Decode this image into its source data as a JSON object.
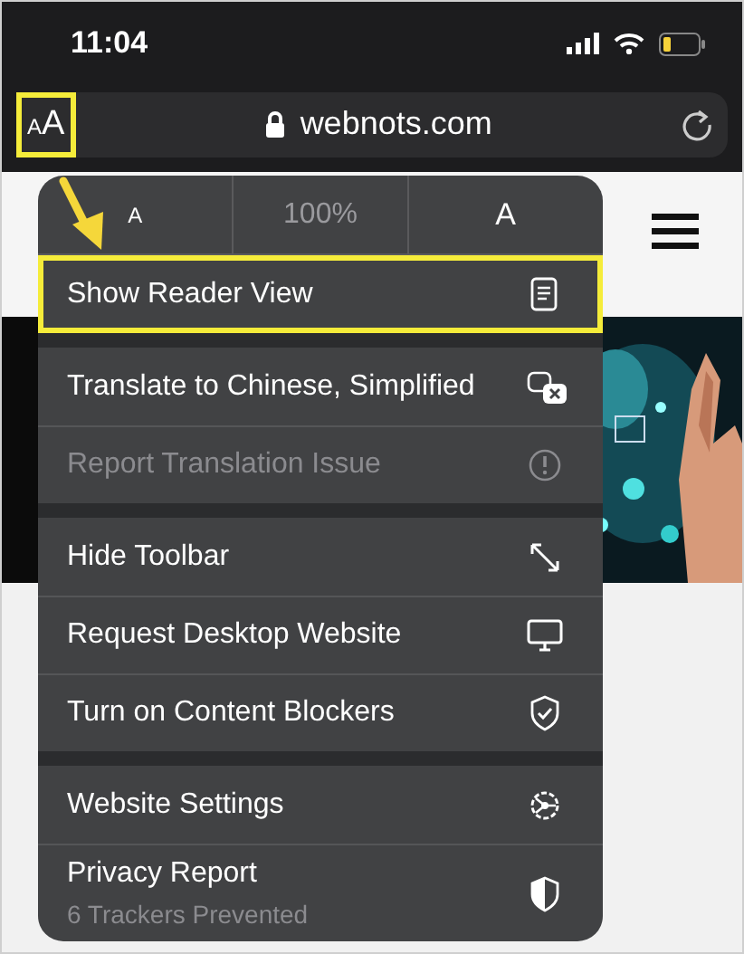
{
  "status_bar": {
    "time": "11:04"
  },
  "address_bar": {
    "text_size_button": {
      "small": "A",
      "large": "A",
      "highlighted": true
    },
    "url": "webnots.com"
  },
  "menu": {
    "font_size": {
      "decrease": "A",
      "zoom": "100%",
      "increase": "A"
    },
    "groups": [
      [
        {
          "label": "Show Reader View",
          "disabled": false,
          "highlighted": true
        }
      ],
      [
        {
          "label": "Translate to Chinese, Simplified",
          "disabled": false,
          "highlighted": false
        },
        {
          "label": "Report Translation Issue",
          "disabled": true,
          "highlighted": false
        }
      ],
      [
        {
          "label": "Hide Toolbar",
          "disabled": false,
          "highlighted": false
        },
        {
          "label": "Request Desktop Website",
          "disabled": false,
          "highlighted": false
        },
        {
          "label": "Turn on Content Blockers",
          "disabled": false,
          "highlighted": false
        }
      ],
      [
        {
          "label": "Website Settings",
          "disabled": false,
          "highlighted": false
        },
        {
          "label": "Privacy Report",
          "subtitle": "6 Trackers Prevented",
          "disabled": false,
          "highlighted": false
        }
      ]
    ]
  }
}
